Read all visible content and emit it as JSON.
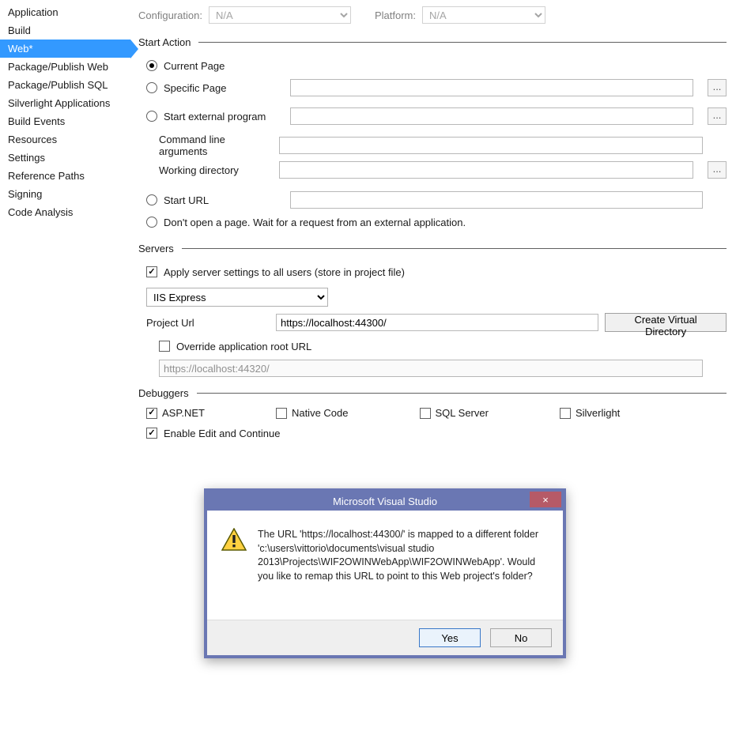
{
  "nav": {
    "items": [
      {
        "label": "Application"
      },
      {
        "label": "Build"
      },
      {
        "label": "Web*",
        "selected": true
      },
      {
        "label": "Package/Publish Web"
      },
      {
        "label": "Package/Publish SQL"
      },
      {
        "label": "Silverlight Applications"
      },
      {
        "label": "Build Events"
      },
      {
        "label": "Resources"
      },
      {
        "label": "Settings"
      },
      {
        "label": "Reference Paths"
      },
      {
        "label": "Signing"
      },
      {
        "label": "Code Analysis"
      }
    ]
  },
  "header": {
    "configuration_label": "Configuration:",
    "configuration_value": "N/A",
    "platform_label": "Platform:",
    "platform_value": "N/A"
  },
  "start_action": {
    "title": "Start Action",
    "current_page": "Current Page",
    "specific_page": "Specific Page",
    "specific_page_value": "",
    "start_external": "Start external program",
    "start_external_value": "",
    "cmd_args_label": "Command line arguments",
    "cmd_args_value": "",
    "workdir_label": "Working directory",
    "workdir_value": "",
    "start_url": "Start URL",
    "start_url_value": "",
    "dont_open": "Don't open a page.  Wait for a request from an external application.",
    "browse": "..."
  },
  "servers": {
    "title": "Servers",
    "apply_all": "Apply server settings to all users (store in project file)",
    "server_type": "IIS Express",
    "project_url_label": "Project Url",
    "project_url_value": "https://localhost:44300/",
    "create_vdir": "Create Virtual Directory",
    "override_root": "Override application root URL",
    "override_root_value": "https://localhost:44320/"
  },
  "debuggers": {
    "title": "Debuggers",
    "aspnet": "ASP.NET",
    "native": "Native Code",
    "sql": "SQL Server",
    "silverlight": "Silverlight",
    "edit_continue": "Enable Edit and Continue"
  },
  "dialog": {
    "title": "Microsoft Visual Studio",
    "close_glyph": "×",
    "message": "The URL 'https://localhost:44300/' is mapped to a different folder 'c:\\users\\vittorio\\documents\\visual studio 2013\\Projects\\WIF2OWINWebApp\\WIF2OWINWebApp'. Would you like to remap this URL to point to this Web project's folder?",
    "yes": "Yes",
    "no": "No"
  }
}
